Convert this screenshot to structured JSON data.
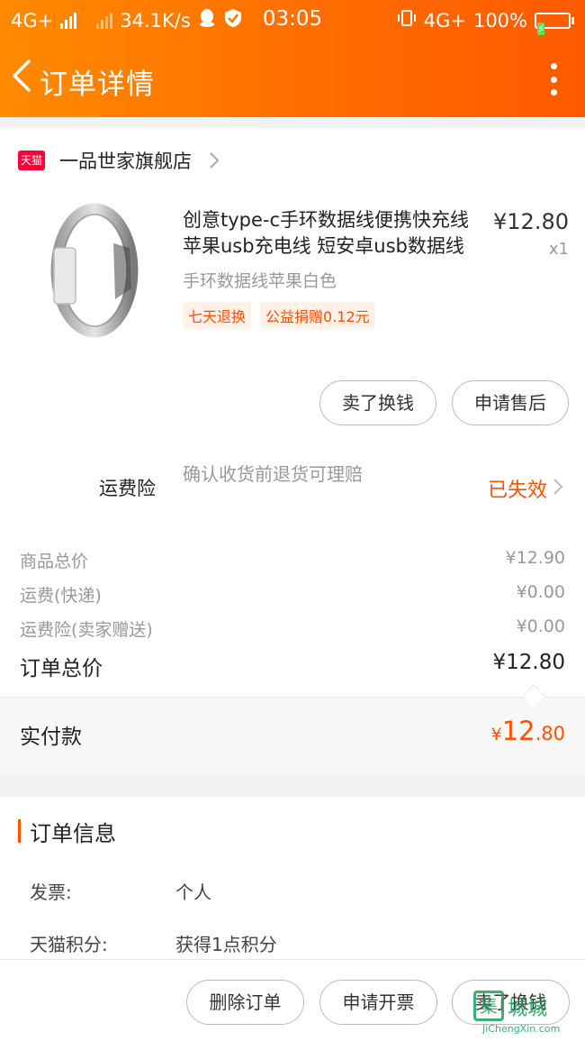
{
  "status_bar": {
    "network_left": "4G+",
    "speed": "34.1K/s",
    "time": "03:05",
    "network_right": "4G+",
    "battery": "100%"
  },
  "nav": {
    "title": "订单详情"
  },
  "shop": {
    "logo": "天猫",
    "name": "一品世家旗舰店"
  },
  "item": {
    "title": "创意type-c手环数据线便携快充线苹果usb充电线 短安卓usb数据线",
    "price": "¥12.80",
    "quantity": "x1",
    "sku": "手环数据线苹果白色",
    "tags": [
      "七天退换",
      "公益捐赠0.12元"
    ]
  },
  "item_actions": {
    "sell": "卖了换钱",
    "after_sale": "申请售后"
  },
  "insurance": {
    "label": "运费险",
    "description": "确认收货前退货可理赔",
    "status": "已失效"
  },
  "fees": [
    {
      "label": "商品总价",
      "value": "¥12.90"
    },
    {
      "label": "运费(快递)",
      "value": "¥0.00"
    },
    {
      "label": "运费险(卖家赠送)",
      "value": "¥0.00"
    }
  ],
  "total": {
    "label": "订单总价",
    "value": "¥12.80"
  },
  "paid": {
    "label": "实付款",
    "currency": "¥",
    "integer": "12",
    "decimal": ".80"
  },
  "order_info": {
    "title": "订单信息",
    "rows": [
      {
        "key": "发票:",
        "value": "个人"
      },
      {
        "key": "天猫积分:",
        "value": "获得1点积分"
      }
    ]
  },
  "bottom_actions": {
    "delete": "删除订单",
    "invoice": "申请开票",
    "sell": "卖了换钱"
  },
  "watermark": {
    "logo": "集",
    "text": "城城",
    "sub": "JiChengXin.com"
  },
  "colors": {
    "header_start": "#ff8a00",
    "header_end": "#ff5a00",
    "accent": "#ff5000",
    "tmall_red": "#ff0036"
  }
}
